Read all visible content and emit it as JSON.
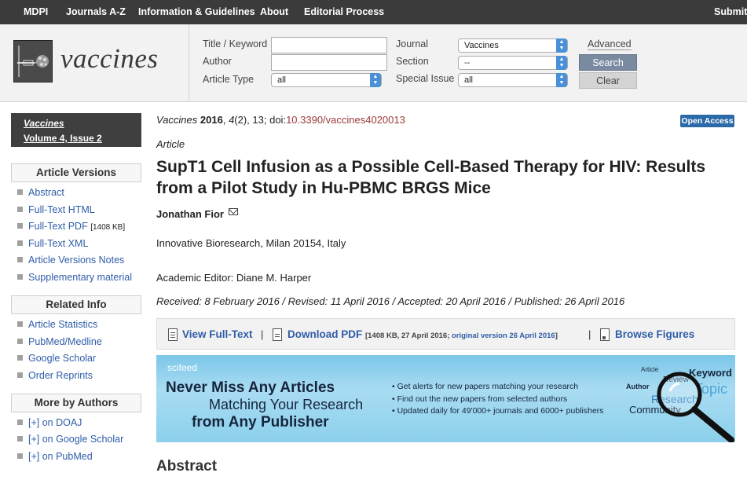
{
  "topnav": {
    "items": [
      "MDPI",
      "Journals A-Z",
      "Information & Guidelines",
      "About",
      "Editorial Process",
      "Submit to"
    ]
  },
  "logo": {
    "text": "vaccines"
  },
  "search": {
    "title_keyword_label": "Title / Keyword",
    "author_label": "Author",
    "article_type_label": "Article Type",
    "article_type_value": "all",
    "journal_label": "Journal",
    "journal_value": "Vaccines",
    "section_label": "Section",
    "section_value": "--",
    "special_issue_label": "Special Issue",
    "special_issue_value": "all",
    "advanced_label": "Advanced",
    "search_button": "Search",
    "clear_button": "Clear"
  },
  "sidebar": {
    "journal_name": "Vaccines",
    "issue": "Volume 4, Issue 2",
    "article_versions_title": "Article Versions",
    "article_versions": [
      "Abstract",
      "Full-Text HTML",
      "Full-Text PDF",
      "Full-Text XML",
      "Article Versions Notes",
      "Supplementary material"
    ],
    "pdf_size": "[1408 KB]",
    "related_info_title": "Related Info",
    "related_info": [
      "Article Statistics",
      "PubMed/Medline",
      "Google Scholar",
      "Order Reprints"
    ],
    "more_by_authors_title": "More by Authors",
    "more_by_authors": [
      "[+] on DOAJ",
      "[+] on Google Scholar",
      "[+] on PubMed"
    ]
  },
  "article": {
    "journal": "Vaccines",
    "year": "2016",
    "volume": "4",
    "issue_pages": "(2), 13; doi:",
    "doi": "10.3390/vaccines4020013",
    "open_access": "Open Access",
    "type": "Article",
    "title": "SupT1 Cell Infusion as a Possible Cell-Based Therapy for HIV: Results from a Pilot Study in Hu-PBMC BRGS Mice",
    "author": "Jonathan Fior",
    "affiliation": "Innovative Bioresearch, Milan 20154, Italy",
    "editor": "Academic Editor: Diane M. Harper",
    "dates": "Received: 8 February 2016 / Revised: 11 April 2016 / Accepted: 20 April 2016 / Published: 26 April 2016"
  },
  "fulltext_bar": {
    "view_full_text": "View Full-Text",
    "download_pdf": "Download PDF",
    "pdf_info_prefix": "[1408 KB, 27 April 2016;",
    "original_version": "original version 26 April 2016",
    "pdf_info_suffix": "]",
    "browse_figures": "Browse Figures",
    "separator": "|"
  },
  "banner": {
    "brand": "scifeed",
    "line1": "Never Miss Any Articles",
    "line2": "Matching Your Research",
    "line3": "from Any Publisher",
    "bullets": [
      "• Get alerts for new papers matching your research",
      "• Find out the new papers from selected authors",
      "• Updated daily for 49'000+ journals and 6000+ publishers"
    ],
    "keywords": [
      "Article",
      "Keyword",
      "Review",
      "Author",
      "Topic",
      "Research",
      "Community"
    ]
  },
  "abstract_heading": "Abstract"
}
